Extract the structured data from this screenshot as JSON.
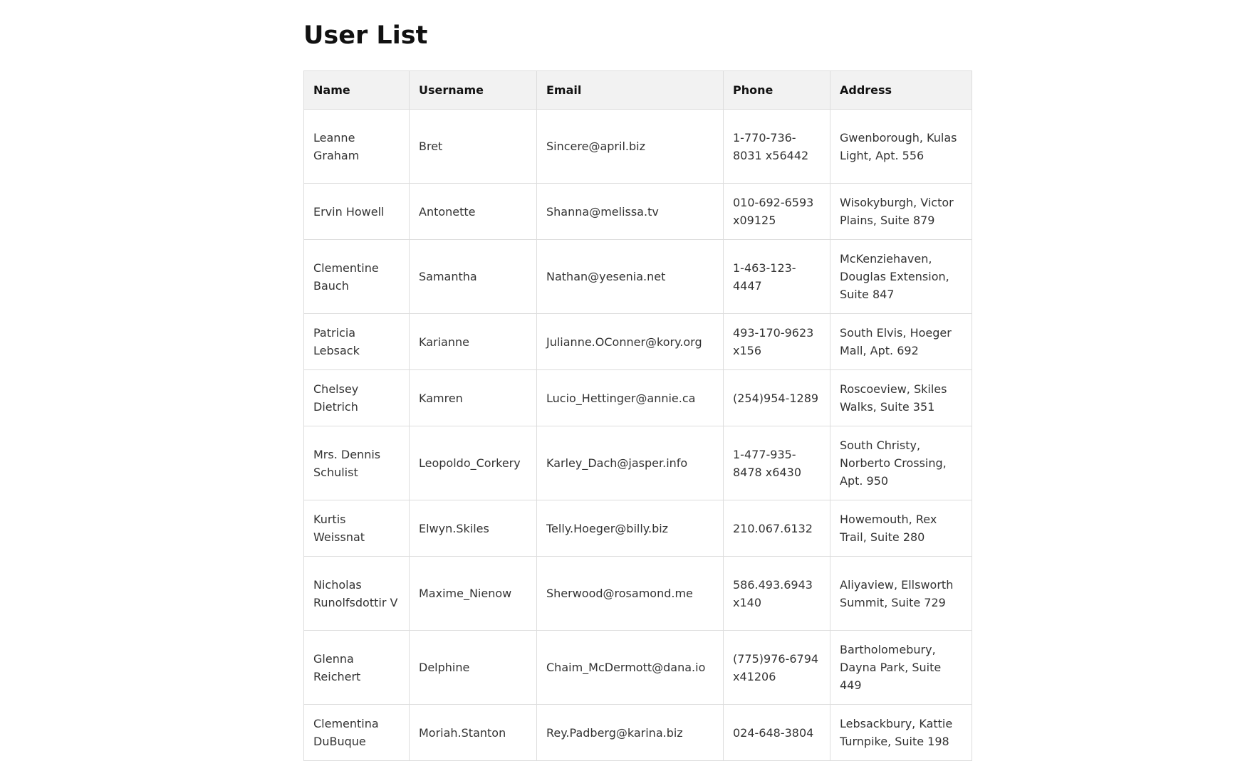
{
  "page": {
    "title": "User List"
  },
  "table": {
    "headers": {
      "name": "Name",
      "username": "Username",
      "email": "Email",
      "phone": "Phone",
      "address": "Address"
    },
    "rows": [
      {
        "name": "Leanne Graham",
        "username": "Bret",
        "email": "Sincere@april.biz",
        "phone": "1-770-736-8031 x56442",
        "address": "Gwenborough, Kulas Light, Apt. 556"
      },
      {
        "name": "Ervin Howell",
        "username": "Antonette",
        "email": "Shanna@melissa.tv",
        "phone": "010-692-6593 x09125",
        "address": "Wisokyburgh, Victor Plains, Suite 879"
      },
      {
        "name": "Clementine Bauch",
        "username": "Samantha",
        "email": "Nathan@yesenia.net",
        "phone": "1-463-123-4447",
        "address": "McKenziehaven, Douglas Extension, Suite 847"
      },
      {
        "name": "Patricia Lebsack",
        "username": "Karianne",
        "email": "Julianne.OConner@kory.org",
        "phone": "493-170-9623 x156",
        "address": "South Elvis, Hoeger Mall, Apt. 692"
      },
      {
        "name": "Chelsey Dietrich",
        "username": "Kamren",
        "email": "Lucio_Hettinger@annie.ca",
        "phone": "(254)954-1289",
        "address": "Roscoeview, Skiles Walks, Suite 351"
      },
      {
        "name": "Mrs. Dennis Schulist",
        "username": "Leopoldo_Corkery",
        "email": "Karley_Dach@jasper.info",
        "phone": "1-477-935-8478 x6430",
        "address": "South Christy, Norberto Crossing, Apt. 950"
      },
      {
        "name": "Kurtis Weissnat",
        "username": "Elwyn.Skiles",
        "email": "Telly.Hoeger@billy.biz",
        "phone": "210.067.6132",
        "address": "Howemouth, Rex Trail, Suite 280"
      },
      {
        "name": "Nicholas Runolfsdottir V",
        "username": "Maxime_Nienow",
        "email": "Sherwood@rosamond.me",
        "phone": "586.493.6943 x140",
        "address": "Aliyaview, Ellsworth Summit, Suite 729"
      },
      {
        "name": "Glenna Reichert",
        "username": "Delphine",
        "email": "Chaim_McDermott@dana.io",
        "phone": "(775)976-6794 x41206",
        "address": "Bartholomebury, Dayna Park, Suite 449"
      },
      {
        "name": "Clementina DuBuque",
        "username": "Moriah.Stanton",
        "email": "Rey.Padberg@karina.biz",
        "phone": "024-648-3804",
        "address": "Lebsackbury, Kattie Turnpike, Suite 198"
      }
    ]
  }
}
